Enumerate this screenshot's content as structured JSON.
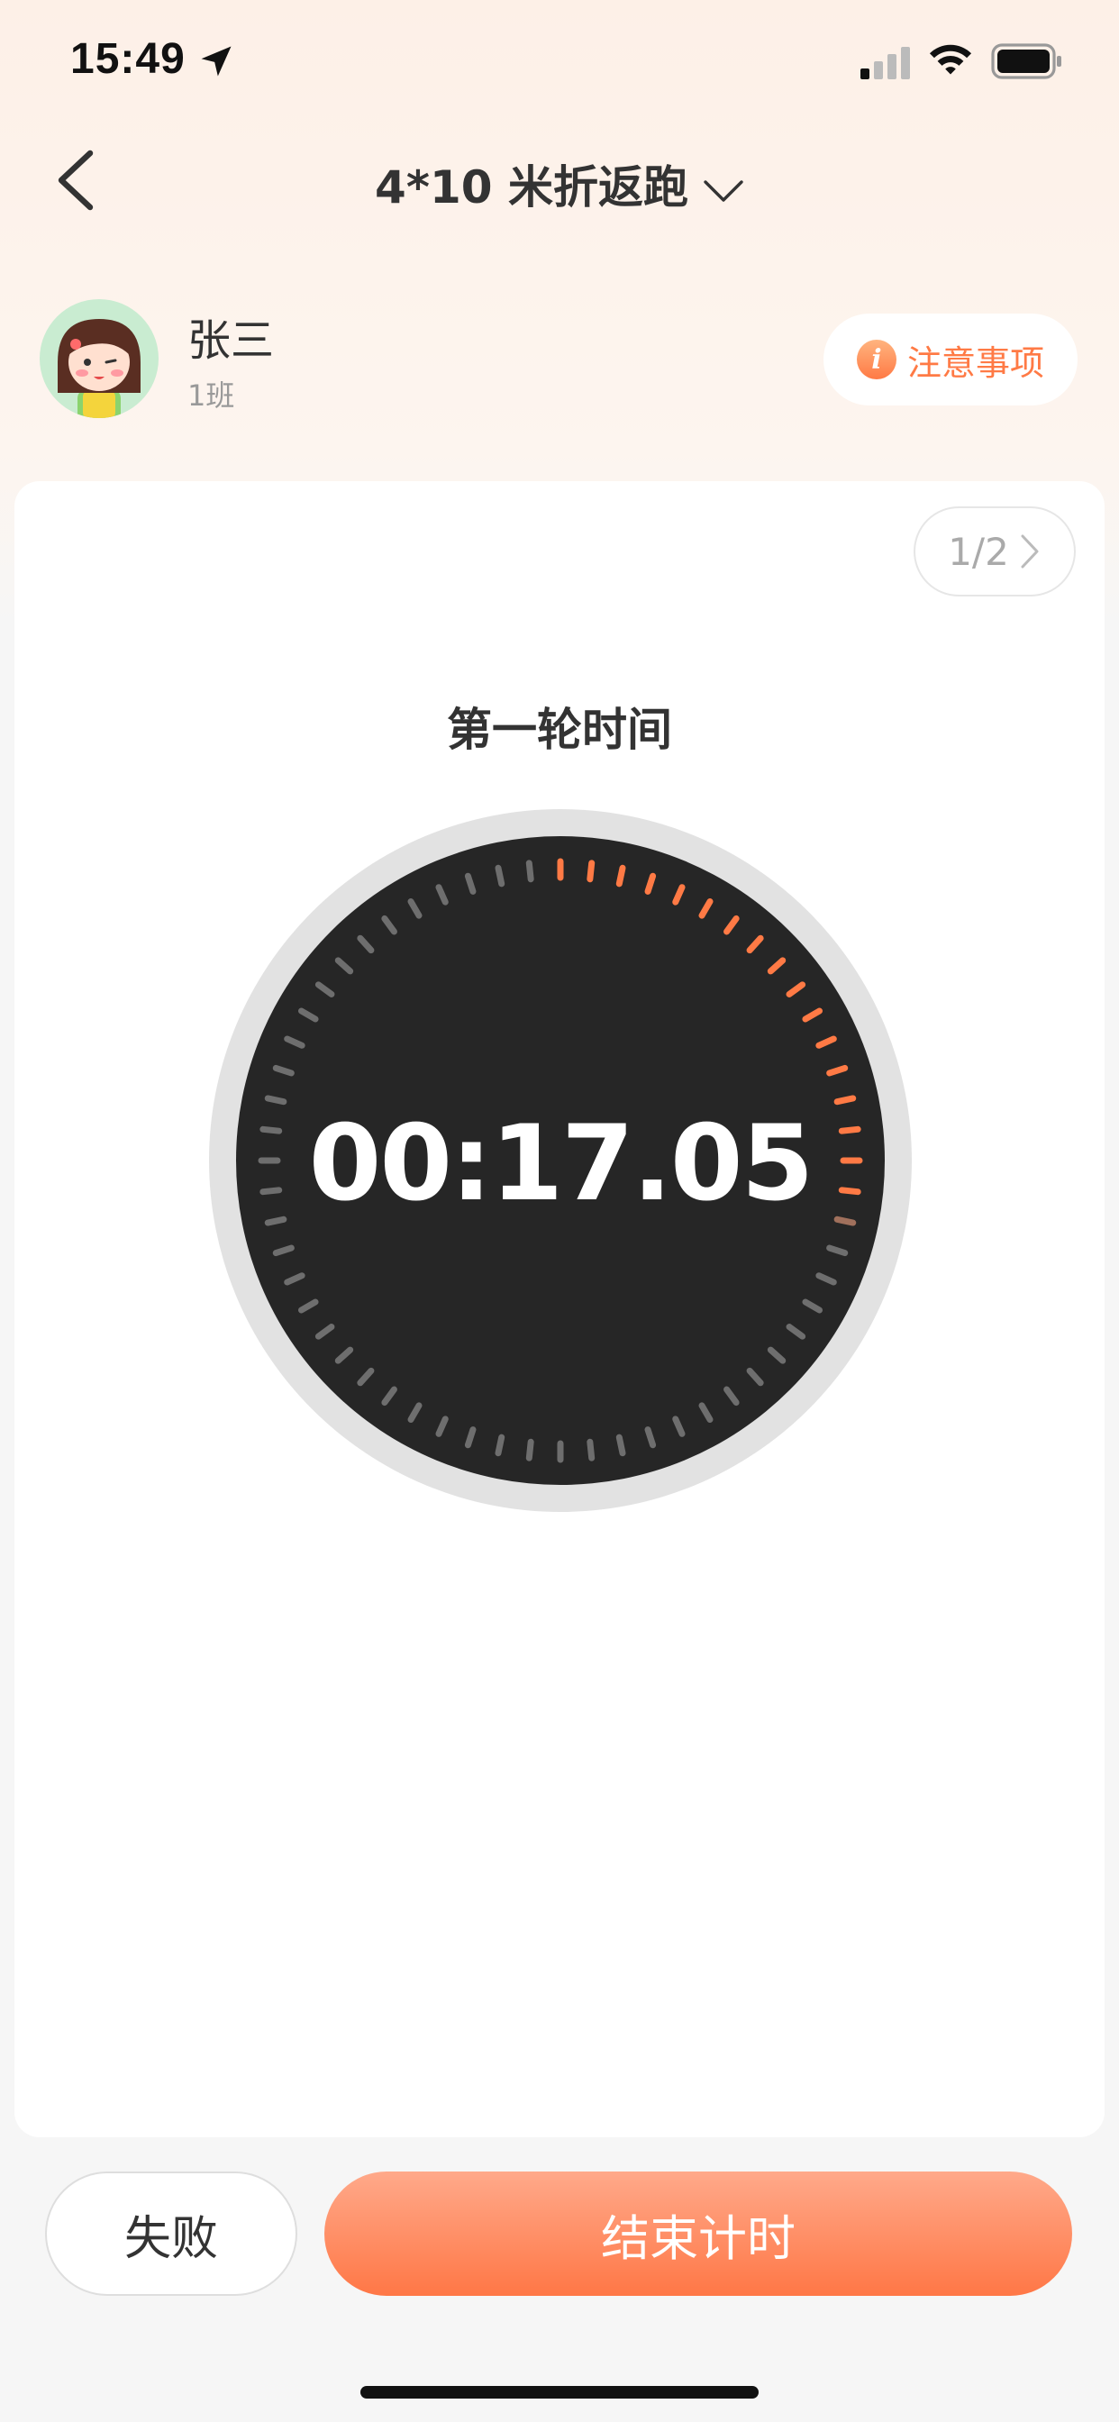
{
  "status_bar": {
    "time": "15:49",
    "icons": [
      "location-arrow-icon",
      "signal-icon",
      "wifi-icon",
      "battery-icon"
    ]
  },
  "nav": {
    "title": "4*10 米折返跑",
    "back_icon": "chevron-left-icon",
    "dropdown_icon": "chevron-down-icon"
  },
  "student": {
    "name": "张三",
    "class": "1班"
  },
  "notice": {
    "label": "注意事项",
    "icon": "info-icon"
  },
  "pager": {
    "label": "1/2"
  },
  "round": {
    "title": "第一轮时间"
  },
  "timer": {
    "display": "00:17.05",
    "progress": 0.2842,
    "ticks": 60
  },
  "actions": {
    "fail_label": "失败",
    "end_label": "结束计时"
  },
  "colors": {
    "accent": "#ff7a45",
    "dial_bg": "#262626",
    "dial_ring": "#e2e2e2",
    "tick_inactive": "#6e6e6e"
  }
}
